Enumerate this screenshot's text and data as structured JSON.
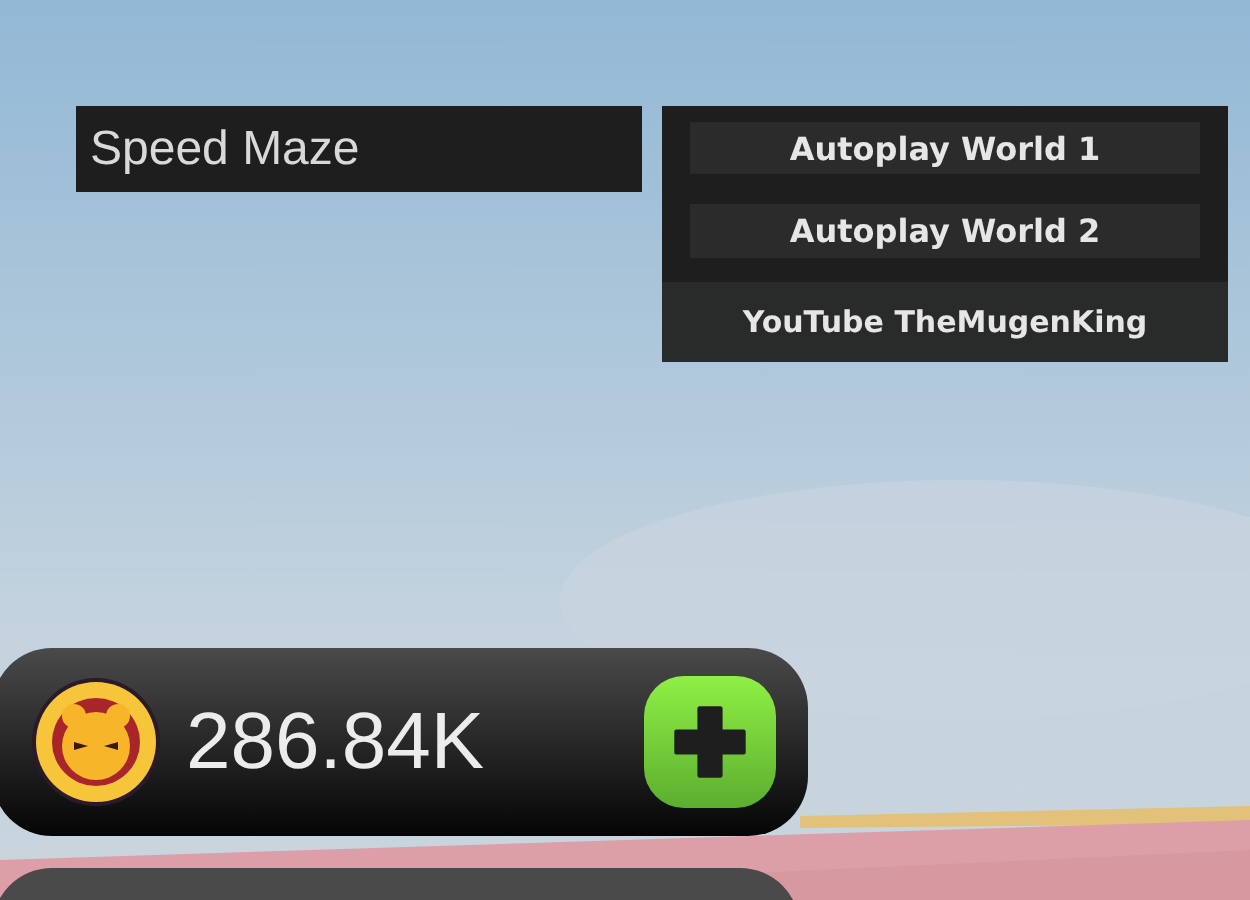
{
  "title": "Speed Maze",
  "buttons": [
    {
      "label": "Autoplay World 1",
      "kind": "inset"
    },
    {
      "label": "Autoplay World 2",
      "kind": "inset"
    },
    {
      "label": "YouTube TheMugenKing",
      "kind": "band"
    }
  ],
  "currency": {
    "value": "286.84K"
  }
}
